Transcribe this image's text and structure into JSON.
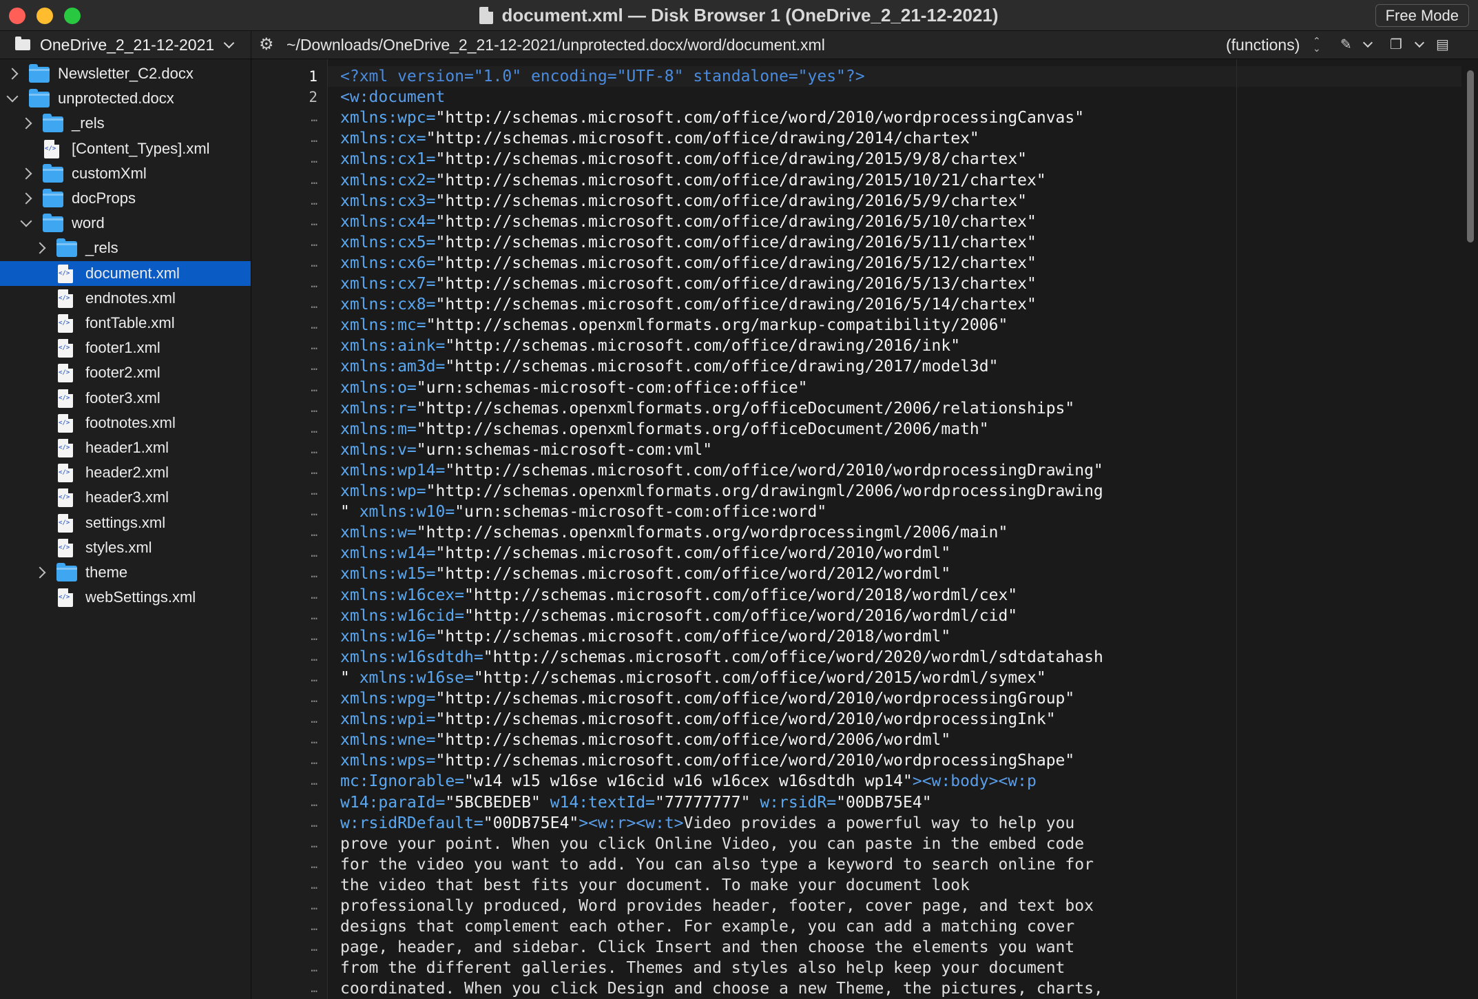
{
  "window": {
    "title": "document.xml — Disk Browser 1 (OneDrive_2_21-12-2021)",
    "mode_button": "Free Mode"
  },
  "pathbar": {
    "volume": "OneDrive_2_21-12-2021",
    "path": "~/Downloads/OneDrive_2_21-12-2021/unprotected.docx/word/document.xml",
    "functions_popup": "(functions)"
  },
  "sidebar": {
    "items": [
      {
        "label": "Newsletter_C2.docx",
        "kind": "folder",
        "depth": 0,
        "disclosure": "closed"
      },
      {
        "label": "unprotected.docx",
        "kind": "folder",
        "depth": 0,
        "disclosure": "open"
      },
      {
        "label": "_rels",
        "kind": "folder",
        "depth": 1,
        "disclosure": "closed"
      },
      {
        "label": "[Content_Types].xml",
        "kind": "file",
        "depth": 1,
        "disclosure": "none"
      },
      {
        "label": "customXml",
        "kind": "folder",
        "depth": 1,
        "disclosure": "closed"
      },
      {
        "label": "docProps",
        "kind": "folder",
        "depth": 1,
        "disclosure": "closed"
      },
      {
        "label": "word",
        "kind": "folder",
        "depth": 1,
        "disclosure": "open"
      },
      {
        "label": "_rels",
        "kind": "folder",
        "depth": 2,
        "disclosure": "closed"
      },
      {
        "label": "document.xml",
        "kind": "file",
        "depth": 2,
        "disclosure": "none",
        "selected": true
      },
      {
        "label": "endnotes.xml",
        "kind": "file",
        "depth": 2,
        "disclosure": "none"
      },
      {
        "label": "fontTable.xml",
        "kind": "file",
        "depth": 2,
        "disclosure": "none"
      },
      {
        "label": "footer1.xml",
        "kind": "file",
        "depth": 2,
        "disclosure": "none"
      },
      {
        "label": "footer2.xml",
        "kind": "file",
        "depth": 2,
        "disclosure": "none"
      },
      {
        "label": "footer3.xml",
        "kind": "file",
        "depth": 2,
        "disclosure": "none"
      },
      {
        "label": "footnotes.xml",
        "kind": "file",
        "depth": 2,
        "disclosure": "none"
      },
      {
        "label": "header1.xml",
        "kind": "file",
        "depth": 2,
        "disclosure": "none"
      },
      {
        "label": "header2.xml",
        "kind": "file",
        "depth": 2,
        "disclosure": "none"
      },
      {
        "label": "header3.xml",
        "kind": "file",
        "depth": 2,
        "disclosure": "none"
      },
      {
        "label": "settings.xml",
        "kind": "file",
        "depth": 2,
        "disclosure": "none"
      },
      {
        "label": "styles.xml",
        "kind": "file",
        "depth": 2,
        "disclosure": "none"
      },
      {
        "label": "theme",
        "kind": "folder",
        "depth": 2,
        "disclosure": "closed"
      },
      {
        "label": "webSettings.xml",
        "kind": "file",
        "depth": 2,
        "disclosure": "none"
      }
    ]
  },
  "editor": {
    "gutter": [
      "1",
      "2",
      "…",
      "…",
      "…",
      "…",
      "…",
      "…",
      "…",
      "…",
      "…",
      "…",
      "…",
      "…",
      "…",
      "…",
      "…",
      "…",
      "…",
      "…",
      "…",
      "…",
      "…",
      "…",
      "…",
      "…",
      "…",
      "…",
      "…",
      "…",
      "…",
      "…",
      "…",
      "…",
      "…",
      "…",
      "…",
      "…",
      "…",
      "…",
      "…",
      "…",
      "…",
      "…",
      "…",
      "…",
      "…"
    ],
    "lines": [
      [
        [
          "pi",
          "<?xml version=\"1.0\" encoding=\"UTF-8\" standalone=\"yes\"?>"
        ]
      ],
      [
        [
          "tag",
          "<w:document"
        ]
      ],
      [
        [
          "attr",
          "xmlns:wpc="
        ],
        [
          "val",
          "\"http://schemas.microsoft.com/office/word/2010/wordprocessingCanvas\""
        ]
      ],
      [
        [
          "attr",
          "xmlns:cx="
        ],
        [
          "val",
          "\"http://schemas.microsoft.com/office/drawing/2014/chartex\""
        ]
      ],
      [
        [
          "attr",
          "xmlns:cx1="
        ],
        [
          "val",
          "\"http://schemas.microsoft.com/office/drawing/2015/9/8/chartex\""
        ]
      ],
      [
        [
          "attr",
          "xmlns:cx2="
        ],
        [
          "val",
          "\"http://schemas.microsoft.com/office/drawing/2015/10/21/chartex\""
        ]
      ],
      [
        [
          "attr",
          "xmlns:cx3="
        ],
        [
          "val",
          "\"http://schemas.microsoft.com/office/drawing/2016/5/9/chartex\""
        ]
      ],
      [
        [
          "attr",
          "xmlns:cx4="
        ],
        [
          "val",
          "\"http://schemas.microsoft.com/office/drawing/2016/5/10/chartex\""
        ]
      ],
      [
        [
          "attr",
          "xmlns:cx5="
        ],
        [
          "val",
          "\"http://schemas.microsoft.com/office/drawing/2016/5/11/chartex\""
        ]
      ],
      [
        [
          "attr",
          "xmlns:cx6="
        ],
        [
          "val",
          "\"http://schemas.microsoft.com/office/drawing/2016/5/12/chartex\""
        ]
      ],
      [
        [
          "attr",
          "xmlns:cx7="
        ],
        [
          "val",
          "\"http://schemas.microsoft.com/office/drawing/2016/5/13/chartex\""
        ]
      ],
      [
        [
          "attr",
          "xmlns:cx8="
        ],
        [
          "val",
          "\"http://schemas.microsoft.com/office/drawing/2016/5/14/chartex\""
        ]
      ],
      [
        [
          "attr",
          "xmlns:mc="
        ],
        [
          "val",
          "\"http://schemas.openxmlformats.org/markup-compatibility/2006\""
        ]
      ],
      [
        [
          "attr",
          "xmlns:aink="
        ],
        [
          "val",
          "\"http://schemas.microsoft.com/office/drawing/2016/ink\""
        ]
      ],
      [
        [
          "attr",
          "xmlns:am3d="
        ],
        [
          "val",
          "\"http://schemas.microsoft.com/office/drawing/2017/model3d\""
        ]
      ],
      [
        [
          "attr",
          "xmlns:o="
        ],
        [
          "val",
          "\"urn:schemas-microsoft-com:office:office\""
        ]
      ],
      [
        [
          "attr",
          "xmlns:r="
        ],
        [
          "val",
          "\"http://schemas.openxmlformats.org/officeDocument/2006/relationships\""
        ]
      ],
      [
        [
          "attr",
          "xmlns:m="
        ],
        [
          "val",
          "\"http://schemas.openxmlformats.org/officeDocument/2006/math\""
        ]
      ],
      [
        [
          "attr",
          "xmlns:v="
        ],
        [
          "val",
          "\"urn:schemas-microsoft-com:vml\""
        ]
      ],
      [
        [
          "attr",
          "xmlns:wp14="
        ],
        [
          "val",
          "\"http://schemas.microsoft.com/office/word/2010/wordprocessingDrawing\""
        ]
      ],
      [
        [
          "attr",
          "xmlns:wp="
        ],
        [
          "val",
          "\"http://schemas.openxmlformats.org/drawingml/2006/wordprocessingDrawing"
        ]
      ],
      [
        [
          "val",
          "\" "
        ],
        [
          "attr",
          "xmlns:w10="
        ],
        [
          "val",
          "\"urn:schemas-microsoft-com:office:word\""
        ]
      ],
      [
        [
          "attr",
          "xmlns:w="
        ],
        [
          "val",
          "\"http://schemas.openxmlformats.org/wordprocessingml/2006/main\""
        ]
      ],
      [
        [
          "attr",
          "xmlns:w14="
        ],
        [
          "val",
          "\"http://schemas.microsoft.com/office/word/2010/wordml\""
        ]
      ],
      [
        [
          "attr",
          "xmlns:w15="
        ],
        [
          "val",
          "\"http://schemas.microsoft.com/office/word/2012/wordml\""
        ]
      ],
      [
        [
          "attr",
          "xmlns:w16cex="
        ],
        [
          "val",
          "\"http://schemas.microsoft.com/office/word/2018/wordml/cex\""
        ]
      ],
      [
        [
          "attr",
          "xmlns:w16cid="
        ],
        [
          "val",
          "\"http://schemas.microsoft.com/office/word/2016/wordml/cid\""
        ]
      ],
      [
        [
          "attr",
          "xmlns:w16="
        ],
        [
          "val",
          "\"http://schemas.microsoft.com/office/word/2018/wordml\""
        ]
      ],
      [
        [
          "attr",
          "xmlns:w16sdtdh="
        ],
        [
          "val",
          "\"http://schemas.microsoft.com/office/word/2020/wordml/sdtdatahash"
        ]
      ],
      [
        [
          "val",
          "\" "
        ],
        [
          "attr",
          "xmlns:w16se="
        ],
        [
          "val",
          "\"http://schemas.microsoft.com/office/word/2015/wordml/symex\""
        ]
      ],
      [
        [
          "attr",
          "xmlns:wpg="
        ],
        [
          "val",
          "\"http://schemas.microsoft.com/office/word/2010/wordprocessingGroup\""
        ]
      ],
      [
        [
          "attr",
          "xmlns:wpi="
        ],
        [
          "val",
          "\"http://schemas.microsoft.com/office/word/2010/wordprocessingInk\""
        ]
      ],
      [
        [
          "attr",
          "xmlns:wne="
        ],
        [
          "val",
          "\"http://schemas.microsoft.com/office/word/2006/wordml\""
        ]
      ],
      [
        [
          "attr",
          "xmlns:wps="
        ],
        [
          "val",
          "\"http://schemas.microsoft.com/office/word/2010/wordprocessingShape\""
        ]
      ],
      [
        [
          "attr",
          "mc:Ignorable="
        ],
        [
          "val",
          "\"w14 w15 w16se w16cid w16 w16cex w16sdtdh wp14\""
        ],
        [
          "tag",
          "><w:body><w:p"
        ]
      ],
      [
        [
          "attr",
          "w14:paraId="
        ],
        [
          "val",
          "\"5BCBEDEB\""
        ],
        [
          "attr",
          " w14:textId="
        ],
        [
          "val",
          "\"77777777\""
        ],
        [
          "attr",
          " w:rsidR="
        ],
        [
          "val",
          "\"00DB75E4\""
        ]
      ],
      [
        [
          "attr",
          "w:rsidRDefault="
        ],
        [
          "val",
          "\"00DB75E4\""
        ],
        [
          "tag",
          "><w:r><w:t>"
        ],
        [
          "text",
          "Video provides a powerful way to help you"
        ]
      ],
      [
        [
          "text",
          "prove your point. When you click Online Video, you can paste in the embed code"
        ]
      ],
      [
        [
          "text",
          "for the video you want to add. You can also type a keyword to search online for"
        ]
      ],
      [
        [
          "text",
          "the video that best fits your document. To make your document look"
        ]
      ],
      [
        [
          "text",
          "professionally produced, Word provides header, footer, cover page, and text box"
        ]
      ],
      [
        [
          "text",
          "designs that complement each other. For example, you can add a matching cover"
        ]
      ],
      [
        [
          "text",
          "page, header, and sidebar. Click Insert and then choose the elements you want"
        ]
      ],
      [
        [
          "text",
          "from the different galleries. Themes and styles also help keep your document"
        ]
      ],
      [
        [
          "text",
          "coordinated. When you click Design and choose a new Theme, the pictures, charts,"
        ]
      ]
    ]
  }
}
